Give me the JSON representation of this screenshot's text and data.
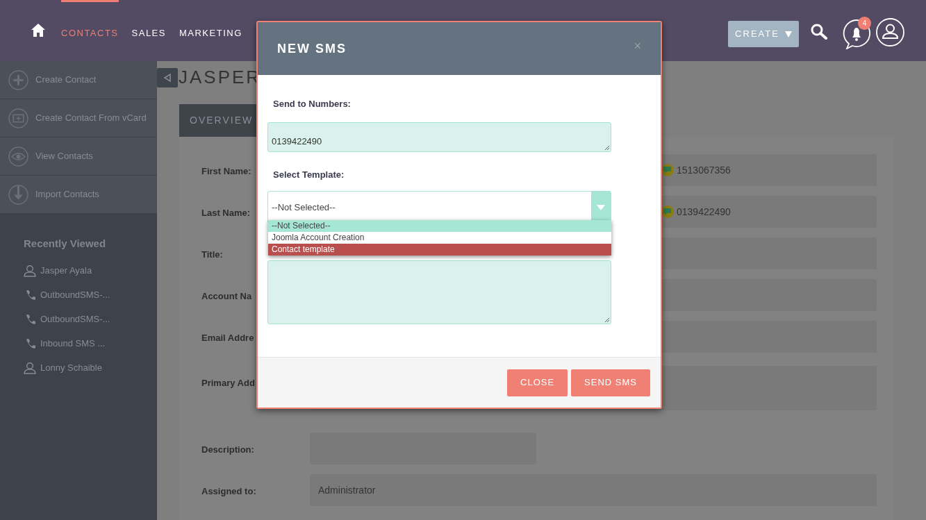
{
  "nav": {
    "items": [
      {
        "label": "CONTACTS",
        "selected": true
      },
      {
        "label": "SALES",
        "selected": false
      },
      {
        "label": "MARKETING",
        "selected": false
      }
    ],
    "create_button": "CREATE",
    "notification_count": "4"
  },
  "sidebar": {
    "actions": [
      {
        "label": "Create Contact",
        "kind": "plus"
      },
      {
        "label": "Create Contact From vCard",
        "kind": "card"
      },
      {
        "label": "View Contacts",
        "kind": "eye"
      },
      {
        "label": "Import Contacts",
        "kind": "import"
      }
    ],
    "recently_viewed": {
      "heading": "Recently Viewed",
      "items": [
        {
          "label": "Jasper Ayala",
          "kind": "person"
        },
        {
          "label": "OutboundSMS-...",
          "kind": "phone"
        },
        {
          "label": "OutboundSMS-...",
          "kind": "phone"
        },
        {
          "label": "Inbound SMS ...",
          "kind": "phone"
        },
        {
          "label": "Lonny Schaible",
          "kind": "person"
        }
      ]
    }
  },
  "record": {
    "title": "JASPER",
    "tab": "OVERVIEW",
    "fields": [
      {
        "label": "First Name:",
        "value": "1513067356",
        "kind": "phone"
      },
      {
        "label": "Last Name:",
        "value": "0139422490",
        "kind": "phone"
      },
      {
        "label": "Title:"
      },
      {
        "label": "Account Na"
      },
      {
        "label": "Email Addre"
      },
      {
        "label": "Primary Add",
        "kind": "address"
      },
      {
        "label": "Description:",
        "kind": "short"
      },
      {
        "label": "Assigned to:",
        "value": "Administrator"
      }
    ]
  },
  "modal": {
    "title": "NEW SMS",
    "close": "×",
    "numbers_label": "Send to Numbers:",
    "numbers_value": "0139422490",
    "template_label": "Select Template:",
    "template_value": "--Not Selected--",
    "template_options": [
      {
        "label": "--Not Selected--",
        "selected": true,
        "hovered": false
      },
      {
        "label": "Joomla Account Creation",
        "selected": false,
        "hovered": false
      },
      {
        "label": "Contact template",
        "selected": false,
        "hovered": true
      }
    ],
    "buttons": [
      "CLOSE",
      "SEND SMS"
    ]
  }
}
